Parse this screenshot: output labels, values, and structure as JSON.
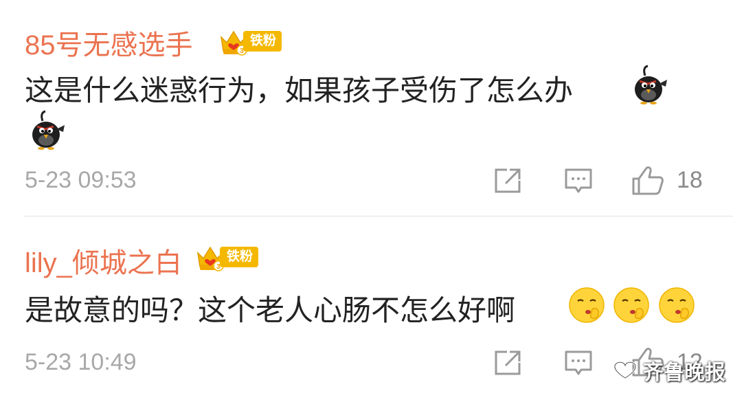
{
  "comments": [
    {
      "username": "85号无感选手",
      "badge": {
        "label": "铁粉",
        "level": "3"
      },
      "text": "这是什么迷惑行为，如果孩子受伤了怎么办",
      "emojis": [
        "angry-bird-bomb-emoji",
        "angry-bird-bomb-emoji"
      ],
      "timestamp": "5-23 09:53",
      "likes": "18"
    },
    {
      "username": "lily_倾城之白",
      "badge": {
        "label": "铁粉",
        "level": "3"
      },
      "text": "是故意的吗？这个老人心肠不怎么好啊",
      "emojis": [
        "shush-face-emoji",
        "shush-face-emoji",
        "shush-face-emoji"
      ],
      "timestamp": "5-23 10:49",
      "likes": "12"
    }
  ],
  "watermark": {
    "text": "齐鲁晚报",
    "icon": "wechat-channel-icon"
  },
  "colors": {
    "username": "#eb7350",
    "badge": "#f5b800",
    "text": "#222222",
    "meta": "#a8a8a8",
    "divider": "#e3e3e3"
  }
}
